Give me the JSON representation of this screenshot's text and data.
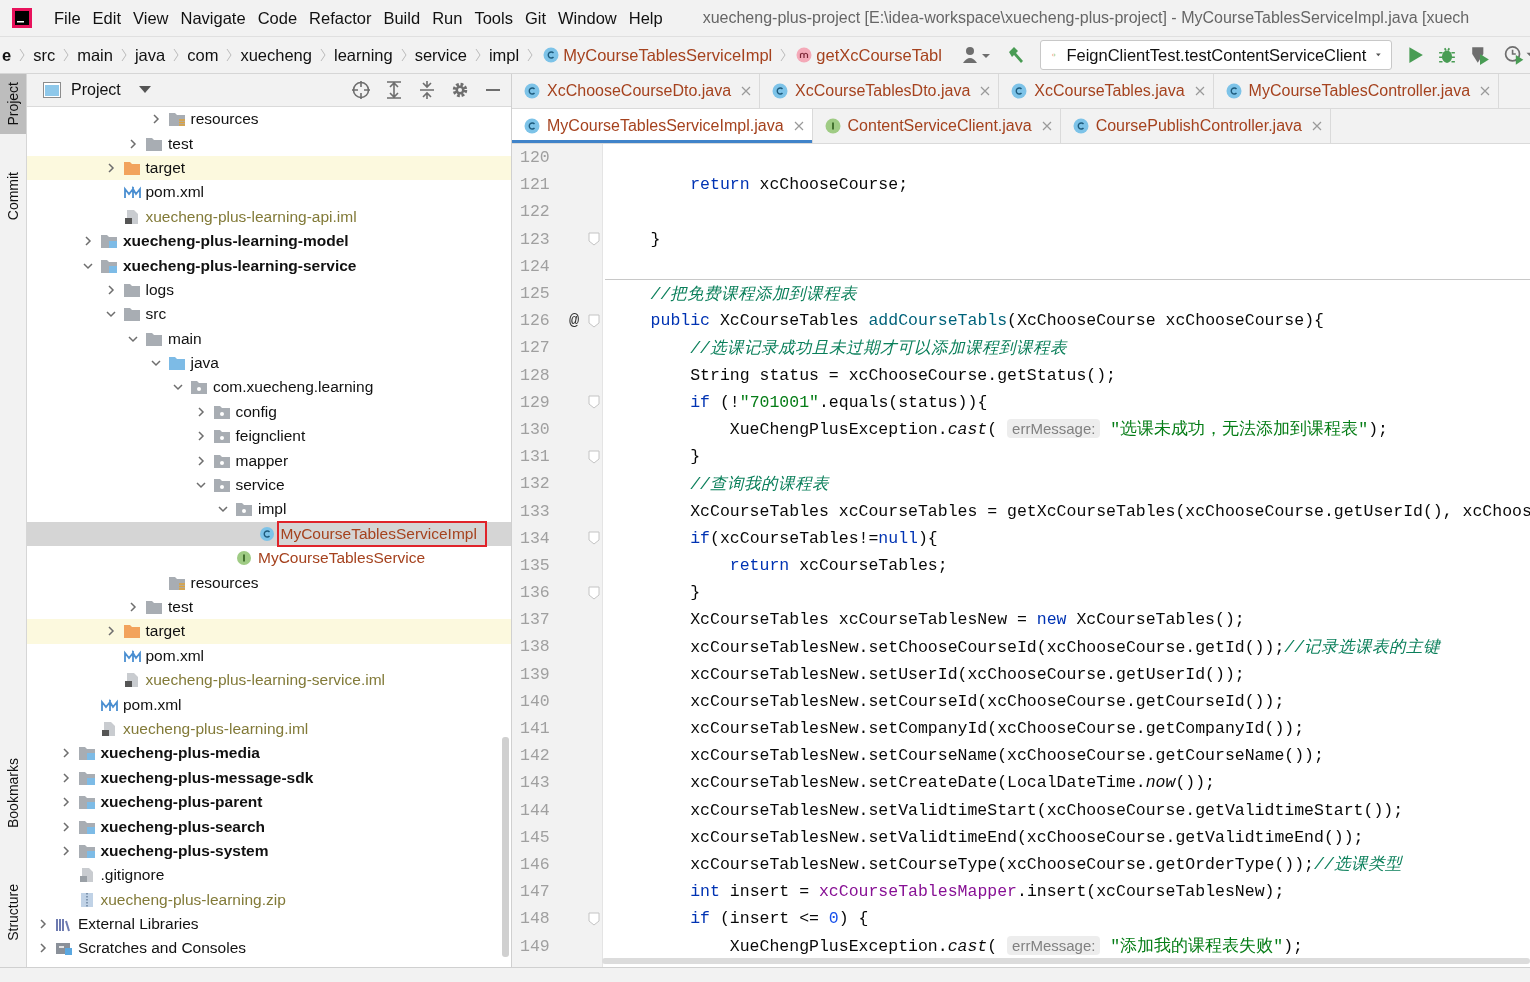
{
  "window": {
    "title": "xuecheng-plus-project [E:\\idea-workspace\\xuecheng-plus-project] - MyCourseTablesServiceImpl.java [xuech"
  },
  "menu": [
    "File",
    "Edit",
    "View",
    "Navigate",
    "Code",
    "Refactor",
    "Build",
    "Run",
    "Tools",
    "Git",
    "Window",
    "Help"
  ],
  "breadcrumbs": [
    {
      "label": "e",
      "kind": "folder"
    },
    {
      "label": "src",
      "kind": "folder"
    },
    {
      "label": "main",
      "kind": "folder"
    },
    {
      "label": "java",
      "kind": "folder"
    },
    {
      "label": "com",
      "kind": "folder"
    },
    {
      "label": "xuecheng",
      "kind": "folder"
    },
    {
      "label": "learning",
      "kind": "folder"
    },
    {
      "label": "service",
      "kind": "folder"
    },
    {
      "label": "impl",
      "kind": "folder"
    },
    {
      "label": "MyCourseTablesServiceImpl",
      "kind": "class"
    },
    {
      "label": "getXcCourseTabl",
      "kind": "method"
    }
  ],
  "run_config": "FeignClientTest.testContentServiceClient",
  "side_tools": [
    {
      "label": "Project",
      "selected": true
    },
    {
      "label": "Commit",
      "selected": false
    },
    {
      "label": "Bookmarks",
      "selected": false
    },
    {
      "label": "Structure",
      "selected": false
    }
  ],
  "project_panel": {
    "title": "Project"
  },
  "tree": [
    {
      "children": [
        {
          "children": [
            {
              "children": [
                {
                  "children": [
                    {
                      "children": [
                        {
                          "label": "resources",
                          "kind": "resource-folder",
                          "expanded": false,
                          "selected": false
                        }
                      ]
                    },
                    {
                      "label": "test",
                      "kind": "folder",
                      "expanded": false,
                      "selected": false
                    }
                  ]
                },
                {
                  "label": "target",
                  "kind": "excluded-folder",
                  "expanded": false,
                  "selected": false
                },
                {
                  "label": "pom.xml",
                  "kind": "maven",
                  "selected": false
                },
                {
                  "label": "xuecheng-plus-learning-api.iml",
                  "kind": "iml",
                  "selected": false
                }
              ]
            },
            {
              "label": "xuecheng-plus-learning-model",
              "kind": "module",
              "expanded": false,
              "selected": false
            },
            {
              "label": "xuecheng-plus-learning-service",
              "kind": "module",
              "expanded": true,
              "selected": false,
              "children": [
                {
                  "label": "logs",
                  "kind": "folder",
                  "expanded": false,
                  "selected": false
                },
                {
                  "label": "src",
                  "kind": "folder",
                  "expanded": true,
                  "selected": false,
                  "children": [
                    {
                      "label": "main",
                      "kind": "folder",
                      "expanded": true,
                      "selected": false,
                      "children": [
                        {
                          "label": "java",
                          "kind": "source-folder",
                          "expanded": true,
                          "selected": false,
                          "children": [
                            {
                              "label": "com.xuecheng.learning",
                              "kind": "package",
                              "expanded": true,
                              "selected": false,
                              "children": [
                                {
                                  "label": "config",
                                  "kind": "package",
                                  "expanded": false,
                                  "selected": false
                                },
                                {
                                  "label": "feignclient",
                                  "kind": "package",
                                  "expanded": false,
                                  "selected": false
                                },
                                {
                                  "label": "mapper",
                                  "kind": "package",
                                  "expanded": false,
                                  "selected": false
                                },
                                {
                                  "label": "service",
                                  "kind": "package",
                                  "expanded": true,
                                  "selected": false,
                                  "children": [
                                    {
                                      "label": "impl",
                                      "kind": "package",
                                      "expanded": true,
                                      "selected": false,
                                      "children": [
                                        {
                                          "label": "MyCourseTablesServiceImpl",
                                          "kind": "class",
                                          "selected": true
                                        }
                                      ]
                                    },
                                    {
                                      "label": "MyCourseTablesService",
                                      "kind": "interface",
                                      "selected": false
                                    }
                                  ]
                                }
                              ]
                            }
                          ]
                        },
                        {
                          "label": "resources",
                          "kind": "resource-folder",
                          "selected": false
                        }
                      ]
                    },
                    {
                      "label": "test",
                      "kind": "folder",
                      "expanded": false,
                      "selected": false
                    }
                  ]
                },
                {
                  "label": "target",
                  "kind": "excluded-folder",
                  "expanded": false,
                  "selected": false
                },
                {
                  "label": "pom.xml",
                  "kind": "maven",
                  "selected": false
                },
                {
                  "label": "xuecheng-plus-learning-service.iml",
                  "kind": "iml",
                  "selected": false
                }
              ]
            },
            {
              "label": "pom.xml",
              "kind": "maven",
              "selected": false
            },
            {
              "label": "xuecheng-plus-learning.iml",
              "kind": "iml",
              "selected": false
            }
          ]
        },
        {
          "label": "xuecheng-plus-media",
          "kind": "module",
          "expanded": false,
          "selected": false
        },
        {
          "label": "xuecheng-plus-message-sdk",
          "kind": "module",
          "expanded": false,
          "selected": false
        },
        {
          "label": "xuecheng-plus-parent",
          "kind": "module",
          "expanded": false,
          "selected": false
        },
        {
          "label": "xuecheng-plus-search",
          "kind": "module",
          "expanded": false,
          "selected": false
        },
        {
          "label": "xuecheng-plus-system",
          "kind": "module",
          "expanded": false,
          "selected": false
        },
        {
          "label": ".gitignore",
          "kind": "gitignore",
          "selected": false
        },
        {
          "label": "xuecheng-plus-learning.zip",
          "kind": "zip",
          "selected": false
        }
      ]
    },
    {
      "label": "External Libraries",
      "kind": "libraries",
      "expanded": false,
      "selected": false
    },
    {
      "label": "Scratches and Consoles",
      "kind": "scratches",
      "expanded": false,
      "selected": false
    }
  ],
  "tab_rows": [
    [
      {
        "label": "XcChooseCourseDto.java",
        "kind": "class",
        "selected": false
      },
      {
        "label": "XcCourseTablesDto.java",
        "kind": "class",
        "selected": false
      },
      {
        "label": "XcCourseTables.java",
        "kind": "class",
        "selected": false
      },
      {
        "label": "MyCourseTablesController.java",
        "kind": "class",
        "selected": false
      }
    ],
    [
      {
        "label": "MyCourseTablesServiceImpl.java",
        "kind": "class",
        "selected": true
      },
      {
        "label": "ContentServiceClient.java",
        "kind": "interface",
        "selected": false
      },
      {
        "label": "CoursePublishController.java",
        "kind": "class",
        "selected": false
      }
    ]
  ],
  "code_lines": [
    {
      "number": "120"
    },
    {
      "number": "121",
      "tokens": [
        {
          "kind": "keyword",
          "text": "        return"
        },
        {
          "kind": "plain",
          "text": " xcChooseCourse;"
        }
      ]
    },
    {
      "number": "122"
    },
    {
      "number": "123",
      "foldable": true,
      "tokens": [
        {
          "kind": "plain",
          "text": "    }"
        }
      ]
    },
    {
      "number": "124",
      "separator": true
    },
    {
      "number": "125",
      "tokens": [
        {
          "kind": "comment",
          "text": "    //把免费课程添加到课程表"
        }
      ]
    },
    {
      "number": "126",
      "marker": "@",
      "foldable": true,
      "tokens": [
        {
          "kind": "keyword",
          "text": "    public"
        },
        {
          "kind": "plain",
          "text": " XcCourseTables "
        },
        {
          "kind": "method",
          "text": "addCourseTabls"
        },
        {
          "kind": "plain",
          "text": "(XcChooseCourse xcChooseCourse){"
        }
      ]
    },
    {
      "number": "127",
      "tokens": [
        {
          "kind": "comment",
          "text": "        //选课记录成功且未过期才可以添加课程到课程表"
        }
      ]
    },
    {
      "number": "128",
      "tokens": [
        {
          "kind": "plain",
          "text": "        String status = xcChooseCourse.getStatus();"
        }
      ]
    },
    {
      "number": "129",
      "foldable": true,
      "tokens": [
        {
          "kind": "keyword",
          "text": "        if"
        },
        {
          "kind": "plain",
          "text": " (!"
        },
        {
          "kind": "string",
          "text": "\"701001\""
        },
        {
          "kind": "plain",
          "text": ".equals(status)){"
        }
      ]
    },
    {
      "number": "130",
      "tokens": [
        {
          "kind": "plain",
          "text": "            XueChengPlusException."
        },
        {
          "kind": "italic",
          "text": "cast"
        },
        {
          "kind": "plain",
          "text": "( "
        },
        {
          "kind": "hint",
          "text": "errMessage:"
        },
        {
          "kind": "string",
          "text": " \"选课未成功，无法添加到课程表\""
        },
        {
          "kind": "plain",
          "text": ");"
        }
      ]
    },
    {
      "number": "131",
      "foldable": true,
      "tokens": [
        {
          "kind": "plain",
          "text": "        }"
        }
      ]
    },
    {
      "number": "132",
      "tokens": [
        {
          "kind": "comment",
          "text": "        //查询我的课程表"
        }
      ]
    },
    {
      "number": "133",
      "tokens": [
        {
          "kind": "plain",
          "text": "        XcCourseTables xcCourseTables = getXcCourseTables(xcChooseCourse.getUserId(), xcChoos"
        }
      ]
    },
    {
      "number": "134",
      "foldable": true,
      "tokens": [
        {
          "kind": "keyword",
          "text": "        if"
        },
        {
          "kind": "plain",
          "text": "(xcCourseTables!="
        },
        {
          "kind": "keyword",
          "text": "null"
        },
        {
          "kind": "plain",
          "text": "){"
        }
      ]
    },
    {
      "number": "135",
      "tokens": [
        {
          "kind": "keyword",
          "text": "            return"
        },
        {
          "kind": "plain",
          "text": " xcCourseTables;"
        }
      ]
    },
    {
      "number": "136",
      "foldable": true,
      "tokens": [
        {
          "kind": "plain",
          "text": "        }"
        }
      ]
    },
    {
      "number": "137",
      "tokens": [
        {
          "kind": "plain",
          "text": "        XcCourseTables xcCourseTablesNew = "
        },
        {
          "kind": "keyword",
          "text": "new"
        },
        {
          "kind": "plain",
          "text": " XcCourseTables();"
        }
      ]
    },
    {
      "number": "138",
      "tokens": [
        {
          "kind": "plain",
          "text": "        xcCourseTablesNew.setChooseCourseId(xcChooseCourse.getId());"
        },
        {
          "kind": "comment",
          "text": "//记录选课表的主键"
        }
      ]
    },
    {
      "number": "139",
      "tokens": [
        {
          "kind": "plain",
          "text": "        xcCourseTablesNew.setUserId(xcChooseCourse.getUserId());"
        }
      ]
    },
    {
      "number": "140",
      "tokens": [
        {
          "kind": "plain",
          "text": "        xcCourseTablesNew.setCourseId(xcChooseCourse.getCourseId());"
        }
      ]
    },
    {
      "number": "141",
      "tokens": [
        {
          "kind": "plain",
          "text": "        xcCourseTablesNew.setCompanyId(xcChooseCourse.getCompanyId());"
        }
      ]
    },
    {
      "number": "142",
      "tokens": [
        {
          "kind": "plain",
          "text": "        xcCourseTablesNew.setCourseName(xcChooseCourse.getCourseName());"
        }
      ]
    },
    {
      "number": "143",
      "tokens": [
        {
          "kind": "plain",
          "text": "        xcCourseTablesNew.setCreateDate(LocalDateTime."
        },
        {
          "kind": "italic",
          "text": "now"
        },
        {
          "kind": "plain",
          "text": "());"
        }
      ]
    },
    {
      "number": "144",
      "tokens": [
        {
          "kind": "plain",
          "text": "        xcCourseTablesNew.setValidtimeStart(xcChooseCourse.getValidtimeStart());"
        }
      ]
    },
    {
      "number": "145",
      "tokens": [
        {
          "kind": "plain",
          "text": "        xcCourseTablesNew.setValidtimeEnd(xcChooseCourse.getValidtimeEnd());"
        }
      ]
    },
    {
      "number": "146",
      "tokens": [
        {
          "kind": "plain",
          "text": "        xcCourseTablesNew.setCourseType(xcChooseCourse.getOrderType());"
        },
        {
          "kind": "comment",
          "text": "//选课类型"
        }
      ]
    },
    {
      "number": "147",
      "tokens": [
        {
          "kind": "keyword",
          "text": "        int"
        },
        {
          "kind": "plain",
          "text": " insert = "
        },
        {
          "kind": "field",
          "text": "xcCourseTablesMapper"
        },
        {
          "kind": "plain",
          "text": ".insert(xcCourseTablesNew);"
        }
      ]
    },
    {
      "number": "148",
      "foldable": true,
      "tokens": [
        {
          "kind": "keyword",
          "text": "        if"
        },
        {
          "kind": "plain",
          "text": " (insert <= "
        },
        {
          "kind": "number",
          "text": "0"
        },
        {
          "kind": "plain",
          "text": ") {"
        }
      ]
    },
    {
      "number": "149",
      "tokens": [
        {
          "kind": "plain",
          "text": "            XueChengPlusException."
        },
        {
          "kind": "italic",
          "text": "cast"
        },
        {
          "kind": "plain",
          "text": "( "
        },
        {
          "kind": "hint",
          "text": "errMessage:"
        },
        {
          "kind": "string",
          "text": " \"添加我的课程表失败\""
        },
        {
          "kind": "plain",
          "text": ");"
        }
      ]
    }
  ]
}
